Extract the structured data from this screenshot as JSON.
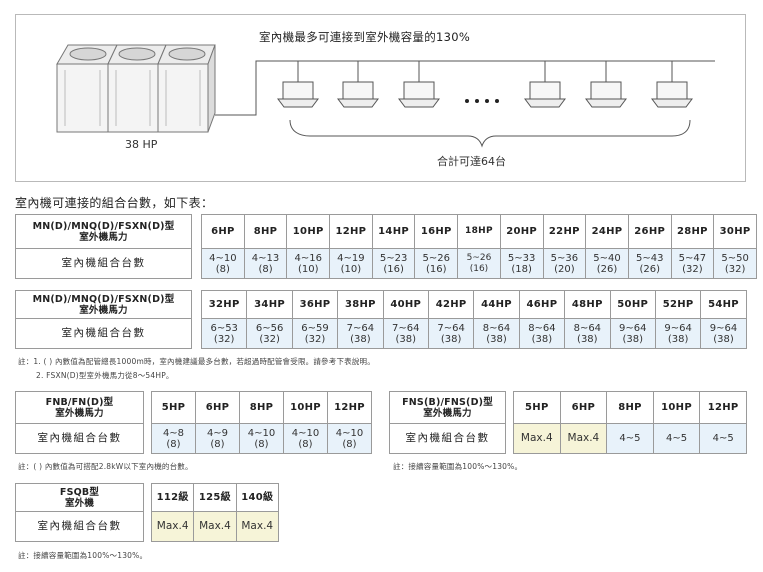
{
  "diagram": {
    "title": "室內機最多可連接到室外機容量的130%",
    "outdoor_label": "38 HP",
    "total_label": "合計可達64台"
  },
  "section_heading": "室內機可連接的組合台數，如下表：",
  "table1": {
    "header_line1": "MN(D)/MNQ(D)/FSXN(D)型",
    "header_line2": "室外機馬力",
    "row_label": "室內機組合台數",
    "hp": [
      "6HP",
      "8HP",
      "10HP",
      "12HP",
      "14HP",
      "16HP",
      "18HP",
      "20HP",
      "22HP",
      "24HP",
      "26HP",
      "28HP",
      "30HP"
    ],
    "ranges": [
      "4~10",
      "4~13",
      "4~16",
      "4~19",
      "5~23",
      "5~26",
      "5~26",
      "5~33",
      "5~36",
      "5~40",
      "5~43",
      "5~47",
      "5~50"
    ],
    "max": [
      "(8)",
      "(8)",
      "(10)",
      "(10)",
      "(16)",
      "(16)",
      "(16)",
      "(18)",
      "(20)",
      "(26)",
      "(26)",
      "(32)",
      "(32)"
    ]
  },
  "table2": {
    "header_line1": "MN(D)/MNQ(D)/FSXN(D)型",
    "header_line2": "室外機馬力",
    "row_label": "室內機組合台數",
    "hp": [
      "32HP",
      "34HP",
      "36HP",
      "38HP",
      "40HP",
      "42HP",
      "44HP",
      "46HP",
      "48HP",
      "50HP",
      "52HP",
      "54HP"
    ],
    "ranges": [
      "6~53",
      "6~56",
      "6~59",
      "7~64",
      "7~64",
      "7~64",
      "8~64",
      "8~64",
      "8~64",
      "9~64",
      "9~64",
      "9~64"
    ],
    "max": [
      "(32)",
      "(32)",
      "(32)",
      "(38)",
      "(38)",
      "(38)",
      "(38)",
      "(38)",
      "(38)",
      "(38)",
      "(38)",
      "(38)"
    ]
  },
  "notes_main": {
    "line1": "註：1. (  ) 內數值為配管總長1000m時，室內機建議最多台數，若超過時配管會受限。請參考下表說明。",
    "line2": "2. FSXN(D)型室外機馬力從8～54HP。"
  },
  "table3": {
    "header_line1": "FNB/FN(D)型",
    "header_line2": "室外機馬力",
    "row_label": "室內機組合台數",
    "hp": [
      "5HP",
      "6HP",
      "8HP",
      "10HP",
      "12HP"
    ],
    "ranges": [
      "4~8",
      "4~9",
      "4~10",
      "4~10",
      "4~10"
    ],
    "max": [
      "(8)",
      "(8)",
      "(8)",
      "(8)",
      "(8)"
    ],
    "note": "註：(  ) 內數值為可搭配2.8kW以下室內機的台數。"
  },
  "table4": {
    "header_line1": "FNS(B)/FNS(D)型",
    "header_line2": "室外機馬力",
    "row_label": "室內機組合台數",
    "hp": [
      "5HP",
      "6HP",
      "8HP",
      "10HP",
      "12HP"
    ],
    "values": [
      "Max.4",
      "Max.4",
      "4~5",
      "4~5",
      "4~5"
    ],
    "note": "註：接續容量範圍為100%～130%。"
  },
  "table5": {
    "header_line1": "FSQB型",
    "header_line2": "室外機",
    "row_label": "室內機組合台數",
    "grades": [
      "112級",
      "125級",
      "140級"
    ],
    "values": [
      "Max.4",
      "Max.4",
      "Max.4"
    ],
    "note": "註：接續容量範圍為100%～130%。"
  },
  "colors": {
    "value_cell_blue": "#e8f2fa",
    "value_cell_yellow": "#f6f4d8",
    "border": "#9a9a9a"
  }
}
